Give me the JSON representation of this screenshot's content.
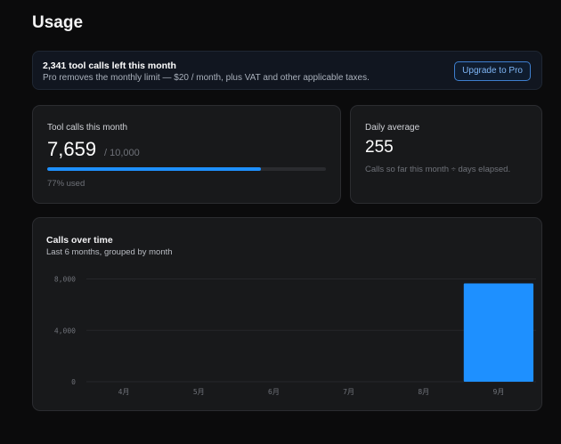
{
  "page": {
    "title": "Usage"
  },
  "banner": {
    "title": "2,341 tool calls left this month",
    "subtitle": "Pro removes the monthly limit — $20 / month, plus VAT and other applicable taxes.",
    "upgrade_label": "Upgrade to Pro"
  },
  "tool_calls": {
    "label": "Tool calls this month",
    "value": "7,659",
    "limit": "/ 10,000",
    "used_fraction": 0.766,
    "used_text": "77% used"
  },
  "daily_average": {
    "label": "Daily average",
    "value": "255",
    "note": "Calls so far this month ÷ days elapsed."
  },
  "chart": {
    "title": "Calls over time",
    "subtitle": "Last 6 months, grouped by month"
  },
  "chart_data": {
    "type": "bar",
    "categories": [
      "4月",
      "5月",
      "6月",
      "7月",
      "8月",
      "9月"
    ],
    "values": [
      0,
      0,
      0,
      0,
      0,
      7659
    ],
    "y_tick_labels": [
      "8,000",
      "4,000",
      "0"
    ],
    "ylim": [
      0,
      8800
    ],
    "grid": true,
    "bar_color": "#1e90ff"
  },
  "colors": {
    "accent": "#1e90ff",
    "background": "#0b0b0c",
    "card": "#18191b"
  }
}
